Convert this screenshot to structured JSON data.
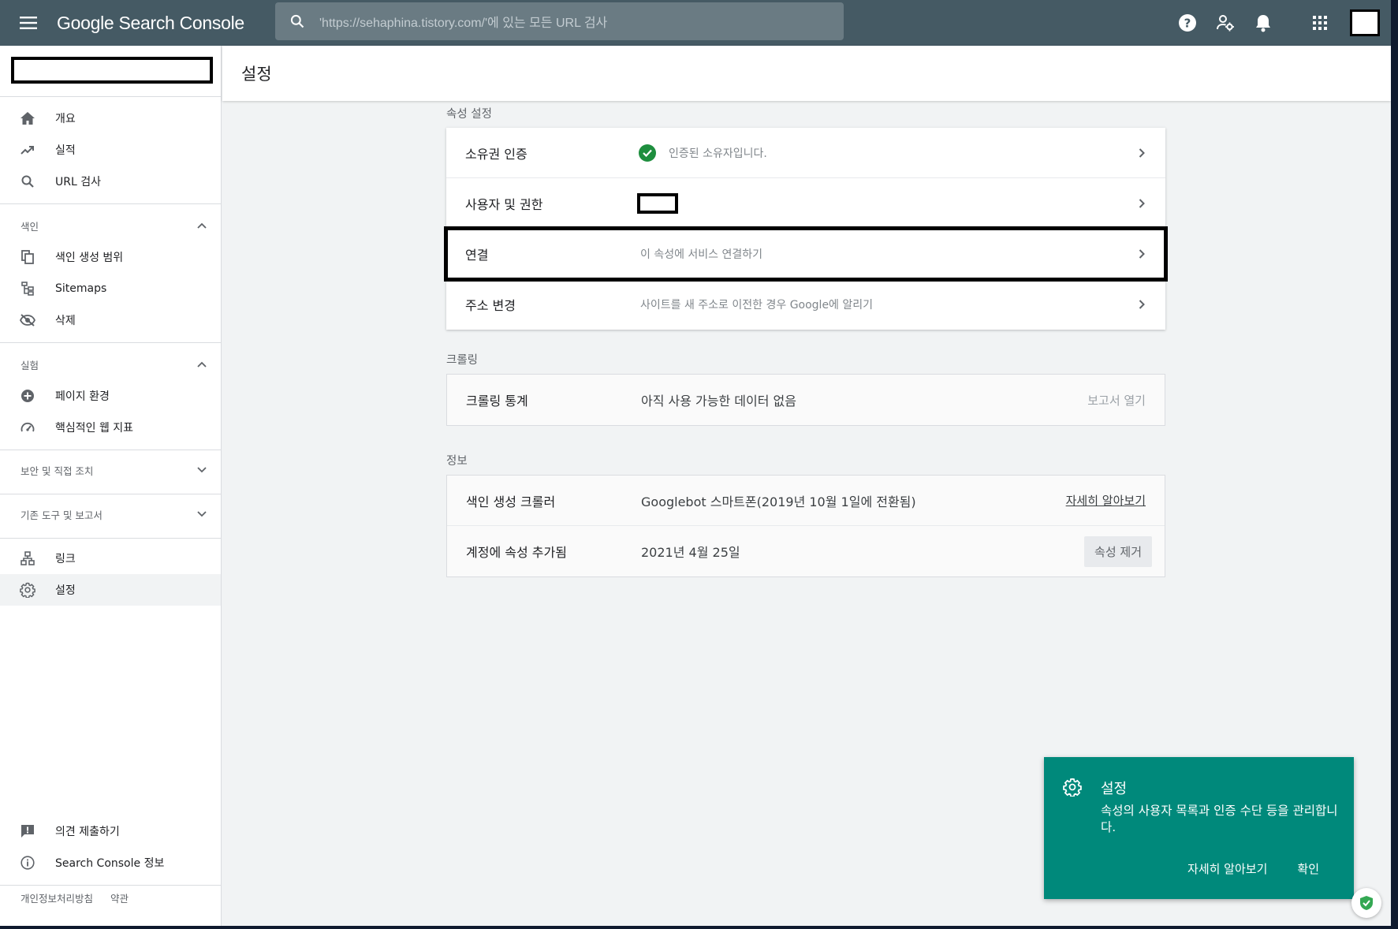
{
  "app": {
    "title": "Google Search Console"
  },
  "search": {
    "placeholder": "'https://sehaphina.tistory.com/'에 있는 모든 URL 검사"
  },
  "topbar_icons": [
    "menu-icon",
    "help-icon",
    "manage-users-icon",
    "notifications-icon",
    "apps-grid-icon"
  ],
  "sidebar": {
    "main_items": [
      {
        "label": "개요",
        "icon": "home-icon"
      },
      {
        "label": "실적",
        "icon": "trending-up-icon"
      },
      {
        "label": "URL 검사",
        "icon": "search-icon"
      }
    ],
    "sections": [
      {
        "label": "색인",
        "expanded": true,
        "items": [
          {
            "label": "색인 생성 범위",
            "icon": "copy-pages-icon"
          },
          {
            "label": "Sitemaps",
            "icon": "sitemap-icon"
          },
          {
            "label": "삭제",
            "icon": "visibility-off-icon"
          }
        ]
      },
      {
        "label": "실험",
        "expanded": true,
        "items": [
          {
            "label": "페이지 환경",
            "icon": "add-circle-icon"
          },
          {
            "label": "핵심적인 웹 지표",
            "icon": "speed-gauge-icon"
          }
        ]
      },
      {
        "label": "보안 및 직접 조치",
        "expanded": false
      },
      {
        "label": "기존 도구 및 보고서",
        "expanded": false
      }
    ],
    "bottom_items": [
      {
        "label": "링크",
        "icon": "links-icon"
      },
      {
        "label": "설정",
        "icon": "gear-icon",
        "active": true
      }
    ],
    "footer_items": [
      {
        "label": "의견 제출하기",
        "icon": "feedback-icon"
      },
      {
        "label": "Search Console 정보",
        "icon": "info-icon"
      }
    ],
    "footer_links": [
      "개인정보처리방침",
      "약관"
    ]
  },
  "page": {
    "title": "설정"
  },
  "property_settings": {
    "section_label": "속성 설정",
    "rows": [
      {
        "label": "소유권 인증",
        "value": "인증된 소유자입니다."
      },
      {
        "label": "사용자 및 권한",
        "value": ""
      },
      {
        "label": "연결",
        "value": "이 속성에 서비스 연결하기"
      },
      {
        "label": "주소 변경",
        "value": "사이트를 새 주소로 이전한 경우 Google에 알리기"
      }
    ]
  },
  "crawling": {
    "section_label": "크롤링",
    "rows": [
      {
        "label": "크롤링 통계",
        "value": "아직 사용 가능한 데이터 없음",
        "action": "보고서 열기"
      }
    ]
  },
  "info": {
    "section_label": "정보",
    "rows": [
      {
        "label": "색인 생성 크롤러",
        "value": "Googlebot 스마트폰(2019년 10월 1일에 전환됨)",
        "action": "자세히 알아보기"
      },
      {
        "label": "계정에 속성 추가됨",
        "value": "2021년 4월 25일",
        "action": "속성 제거"
      }
    ]
  },
  "toast": {
    "title": "설정",
    "body": "속성의 사용자 목록과 인증 수단 등을 관리합니다.",
    "learn_more": "자세히 알아보기",
    "confirm": "확인"
  },
  "colors": {
    "topbar": "#455a64",
    "toast": "#00897b",
    "success": "#1e8e3e"
  }
}
